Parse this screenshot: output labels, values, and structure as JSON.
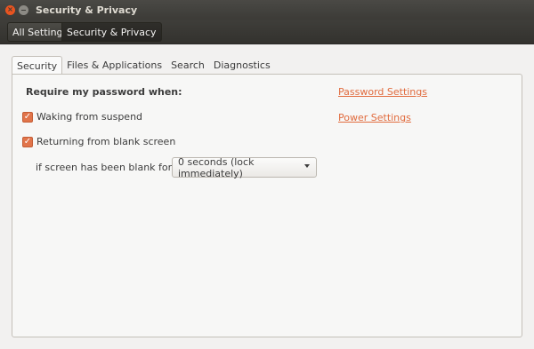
{
  "window": {
    "title": "Security & Privacy"
  },
  "breadcrumb": {
    "items": [
      "All Settings",
      "Security & Privacy"
    ]
  },
  "tabs": [
    {
      "label": "Security",
      "active": true
    },
    {
      "label": "Files & Applications",
      "active": false
    },
    {
      "label": "Search",
      "active": false
    },
    {
      "label": "Diagnostics",
      "active": false
    }
  ],
  "security": {
    "heading": "Require my password when:",
    "options": [
      {
        "label": "Waking from suspend",
        "checked": true
      },
      {
        "label": "Returning from blank screen",
        "checked": true
      }
    ],
    "blank_label": "if screen has been blank for",
    "blank_value": "0 seconds (lock immediately)",
    "links": {
      "password": "Password Settings",
      "power": "Power Settings"
    }
  },
  "colors": {
    "accent": "#e16c3f",
    "checkbox": "#e1744a",
    "titlebar": "#3c3b37"
  }
}
